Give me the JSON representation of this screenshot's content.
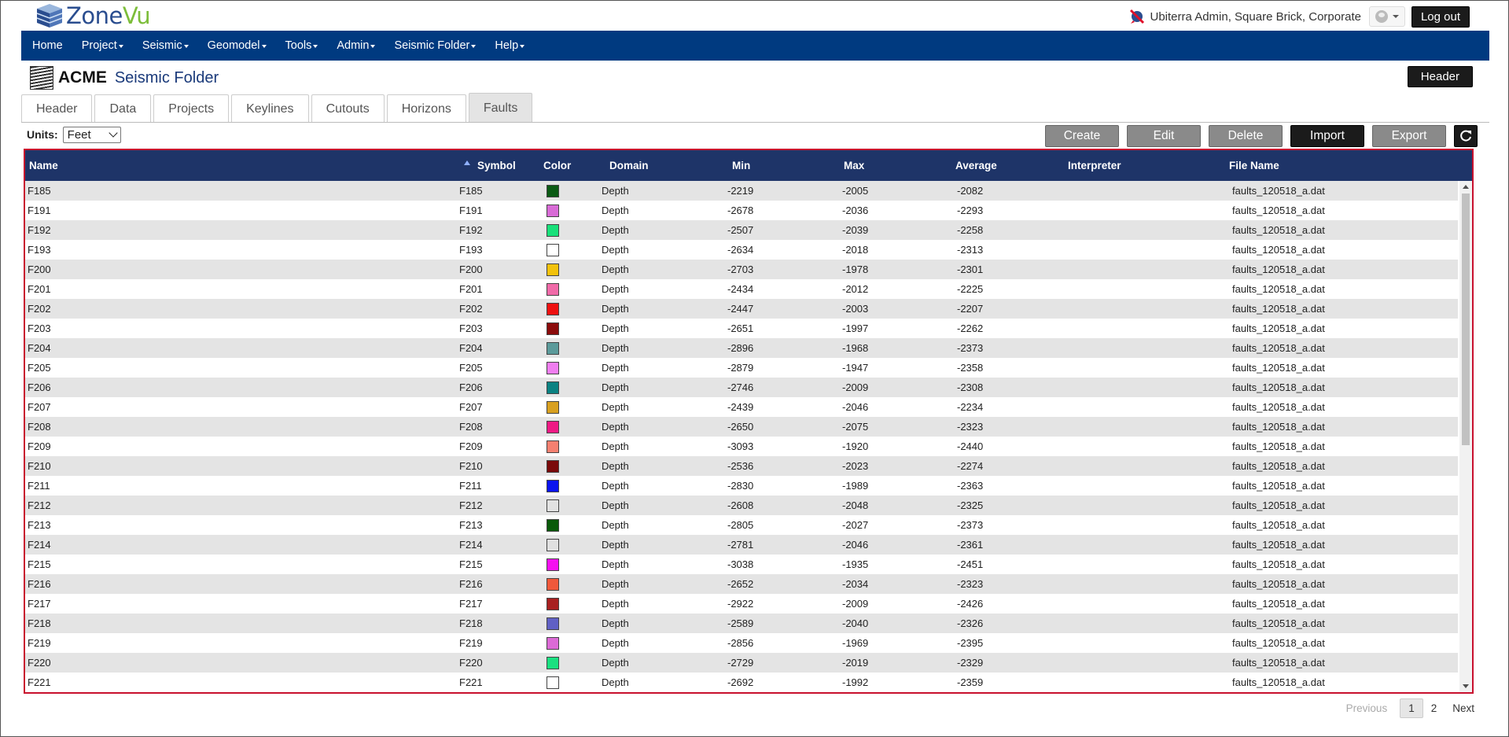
{
  "brand": {
    "name_part1": "Zone",
    "name_part2": "Vu"
  },
  "user": {
    "label": "Ubiterra Admin, Square Brick, Corporate",
    "logout_label": "Log out"
  },
  "nav": [
    "Home",
    "Project",
    "Seismic",
    "Geomodel",
    "Tools",
    "Admin",
    "Seismic Folder",
    "Help"
  ],
  "folder": {
    "company": "ACME",
    "title": "Seismic Folder",
    "header_button": "Header"
  },
  "tabs": [
    "Header",
    "Data",
    "Projects",
    "Keylines",
    "Cutouts",
    "Horizons",
    "Faults"
  ],
  "active_tab": "Faults",
  "units": {
    "label": "Units:",
    "value": "Feet"
  },
  "toolbar": {
    "create": "Create",
    "edit": "Edit",
    "delete": "Delete",
    "import": "Import",
    "export": "Export"
  },
  "table": {
    "columns": [
      "Name",
      "Symbol",
      "Color",
      "Domain",
      "Min",
      "Max",
      "Average",
      "Interpreter",
      "File Name"
    ],
    "sorted_column": "Symbol",
    "rows": [
      {
        "name": "F185",
        "symbol": "F185",
        "color": "#0b5a14",
        "domain": "Depth",
        "min": "-2219",
        "max": "-2005",
        "avg": "-2082",
        "interpreter": "",
        "file": "faults_120518_a.dat"
      },
      {
        "name": "F191",
        "symbol": "F191",
        "color": "#d86bd6",
        "domain": "Depth",
        "min": "-2678",
        "max": "-2036",
        "avg": "-2293",
        "interpreter": "",
        "file": "faults_120518_a.dat"
      },
      {
        "name": "F192",
        "symbol": "F192",
        "color": "#18e07a",
        "domain": "Depth",
        "min": "-2507",
        "max": "-2039",
        "avg": "-2258",
        "interpreter": "",
        "file": "faults_120518_a.dat"
      },
      {
        "name": "F193",
        "symbol": "F193",
        "color": "#ffffff",
        "domain": "Depth",
        "min": "-2634",
        "max": "-2018",
        "avg": "-2313",
        "interpreter": "",
        "file": "faults_120518_a.dat"
      },
      {
        "name": "F200",
        "symbol": "F200",
        "color": "#f2c20c",
        "domain": "Depth",
        "min": "-2703",
        "max": "-1978",
        "avg": "-2301",
        "interpreter": "",
        "file": "faults_120518_a.dat"
      },
      {
        "name": "F201",
        "symbol": "F201",
        "color": "#f06aa8",
        "domain": "Depth",
        "min": "-2434",
        "max": "-2012",
        "avg": "-2225",
        "interpreter": "",
        "file": "faults_120518_a.dat"
      },
      {
        "name": "F202",
        "symbol": "F202",
        "color": "#ee1111",
        "domain": "Depth",
        "min": "-2447",
        "max": "-2003",
        "avg": "-2207",
        "interpreter": "",
        "file": "faults_120518_a.dat"
      },
      {
        "name": "F203",
        "symbol": "F203",
        "color": "#8b0b0b",
        "domain": "Depth",
        "min": "-2651",
        "max": "-1997",
        "avg": "-2262",
        "interpreter": "",
        "file": "faults_120518_a.dat"
      },
      {
        "name": "F204",
        "symbol": "F204",
        "color": "#5b9a9a",
        "domain": "Depth",
        "min": "-2896",
        "max": "-1968",
        "avg": "-2373",
        "interpreter": "",
        "file": "faults_120518_a.dat"
      },
      {
        "name": "F205",
        "symbol": "F205",
        "color": "#f07ef0",
        "domain": "Depth",
        "min": "-2879",
        "max": "-1947",
        "avg": "-2358",
        "interpreter": "",
        "file": "faults_120518_a.dat"
      },
      {
        "name": "F206",
        "symbol": "F206",
        "color": "#0b8282",
        "domain": "Depth",
        "min": "-2746",
        "max": "-2009",
        "avg": "-2308",
        "interpreter": "",
        "file": "faults_120518_a.dat"
      },
      {
        "name": "F207",
        "symbol": "F207",
        "color": "#d8a020",
        "domain": "Depth",
        "min": "-2439",
        "max": "-2046",
        "avg": "-2234",
        "interpreter": "",
        "file": "faults_120518_a.dat"
      },
      {
        "name": "F208",
        "symbol": "F208",
        "color": "#ee1a84",
        "domain": "Depth",
        "min": "-2650",
        "max": "-2075",
        "avg": "-2323",
        "interpreter": "",
        "file": "faults_120518_a.dat"
      },
      {
        "name": "F209",
        "symbol": "F209",
        "color": "#f58070",
        "domain": "Depth",
        "min": "-3093",
        "max": "-1920",
        "avg": "-2440",
        "interpreter": "",
        "file": "faults_120518_a.dat"
      },
      {
        "name": "F210",
        "symbol": "F210",
        "color": "#7a0a0a",
        "domain": "Depth",
        "min": "-2536",
        "max": "-2023",
        "avg": "-2274",
        "interpreter": "",
        "file": "faults_120518_a.dat"
      },
      {
        "name": "F211",
        "symbol": "F211",
        "color": "#0a14ee",
        "domain": "Depth",
        "min": "-2830",
        "max": "-1989",
        "avg": "-2363",
        "interpreter": "",
        "file": "faults_120518_a.dat"
      },
      {
        "name": "F212",
        "symbol": "F212",
        "color": "#e2e2e2",
        "domain": "Depth",
        "min": "-2608",
        "max": "-2048",
        "avg": "-2325",
        "interpreter": "",
        "file": "faults_120518_a.dat"
      },
      {
        "name": "F213",
        "symbol": "F213",
        "color": "#0a5a0a",
        "domain": "Depth",
        "min": "-2805",
        "max": "-2027",
        "avg": "-2373",
        "interpreter": "",
        "file": "faults_120518_a.dat"
      },
      {
        "name": "F214",
        "symbol": "F214",
        "color": "#e0e0e0",
        "domain": "Depth",
        "min": "-2781",
        "max": "-2046",
        "avg": "-2361",
        "interpreter": "",
        "file": "faults_120518_a.dat"
      },
      {
        "name": "F215",
        "symbol": "F215",
        "color": "#f510f0",
        "domain": "Depth",
        "min": "-3038",
        "max": "-1935",
        "avg": "-2451",
        "interpreter": "",
        "file": "faults_120518_a.dat"
      },
      {
        "name": "F216",
        "symbol": "F216",
        "color": "#f0583a",
        "domain": "Depth",
        "min": "-2652",
        "max": "-2034",
        "avg": "-2323",
        "interpreter": "",
        "file": "faults_120518_a.dat"
      },
      {
        "name": "F217",
        "symbol": "F217",
        "color": "#a82020",
        "domain": "Depth",
        "min": "-2922",
        "max": "-2009",
        "avg": "-2426",
        "interpreter": "",
        "file": "faults_120518_a.dat"
      },
      {
        "name": "F218",
        "symbol": "F218",
        "color": "#6060c4",
        "domain": "Depth",
        "min": "-2589",
        "max": "-2040",
        "avg": "-2326",
        "interpreter": "",
        "file": "faults_120518_a.dat"
      },
      {
        "name": "F219",
        "symbol": "F219",
        "color": "#dc6ad6",
        "domain": "Depth",
        "min": "-2856",
        "max": "-1969",
        "avg": "-2395",
        "interpreter": "",
        "file": "faults_120518_a.dat"
      },
      {
        "name": "F220",
        "symbol": "F220",
        "color": "#1ae080",
        "domain": "Depth",
        "min": "-2729",
        "max": "-2019",
        "avg": "-2329",
        "interpreter": "",
        "file": "faults_120518_a.dat"
      },
      {
        "name": "F221",
        "symbol": "F221",
        "color": "#ffffff",
        "domain": "Depth",
        "min": "-2692",
        "max": "-1992",
        "avg": "-2359",
        "interpreter": "",
        "file": "faults_120518_a.dat"
      }
    ]
  },
  "pagination": {
    "previous": "Previous",
    "pages": [
      "1",
      "2"
    ],
    "current": "1",
    "next": "Next"
  },
  "icons": {
    "brand": "zonevu-cube-icon",
    "user": "user-status-icon",
    "avatar": "avatar-icon",
    "folder": "seismic-folder-icon",
    "refresh": "refresh-icon",
    "sort": "sort-ascending-icon"
  },
  "theme": {
    "nav_bg": "#003a80",
    "grid_header_bg": "#1e3468",
    "grid_border": "#c8102e",
    "row_alt": "#e4e4e4"
  }
}
